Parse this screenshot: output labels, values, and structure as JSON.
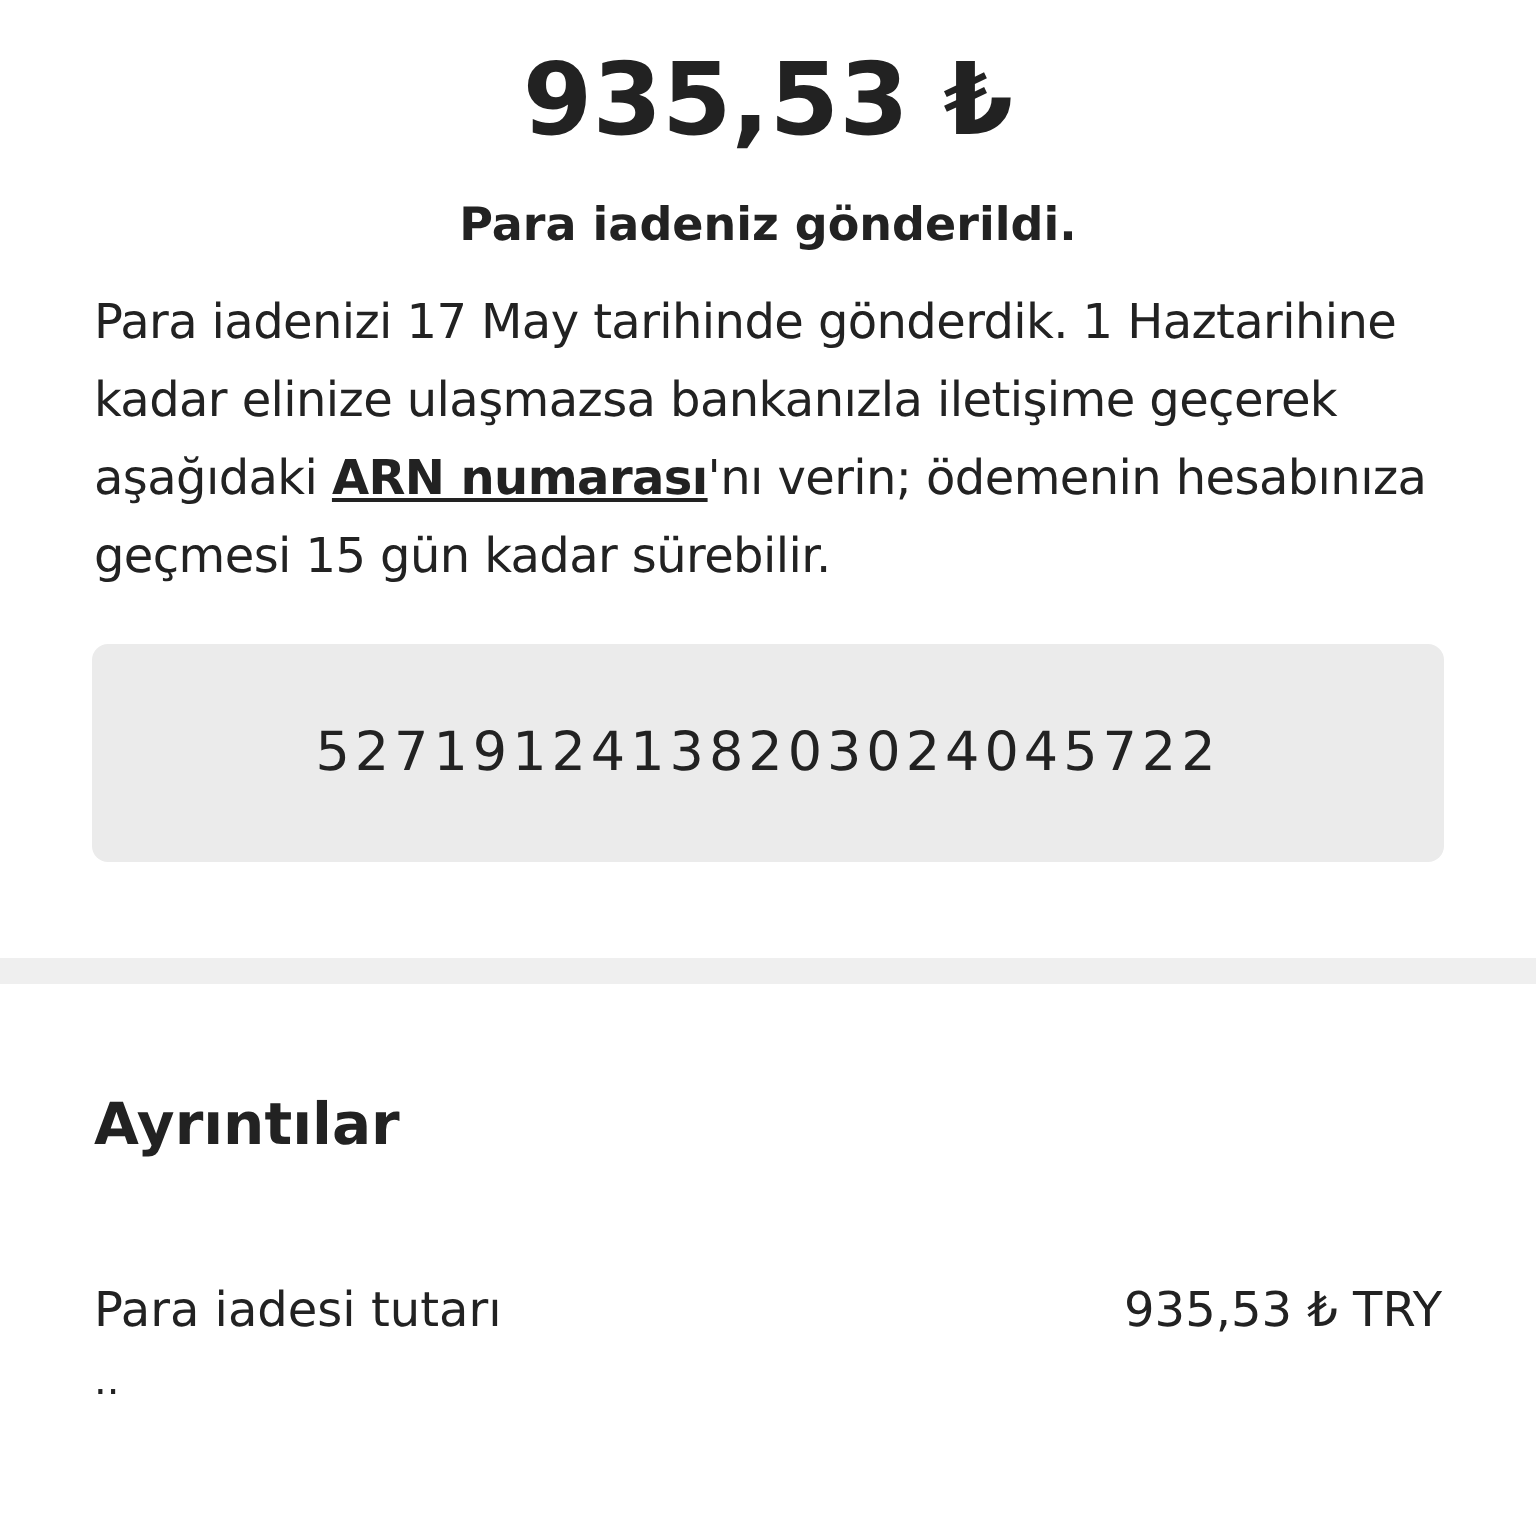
{
  "amount": "935,53 ₺",
  "status": "Para iadeniz gönderildi.",
  "message": {
    "before": "Para iadenizi 17 May tarihinde gönderdik. 1 Haztarihine kadar elinize ulaşmazsa bankanızla iletişime geçerek aşağıdaki ",
    "link": "ARN numarası",
    "after": "'nı verin; ödemenin hesabınıza geçmesi 15 gün kadar sürebilir."
  },
  "arn": "52719124138203024045722",
  "details": {
    "title": "Ayrıntılar",
    "rows": [
      {
        "label": "Para iadesi tutarı",
        "value": "935,53 ₺ TRY"
      }
    ],
    "more": ".."
  }
}
